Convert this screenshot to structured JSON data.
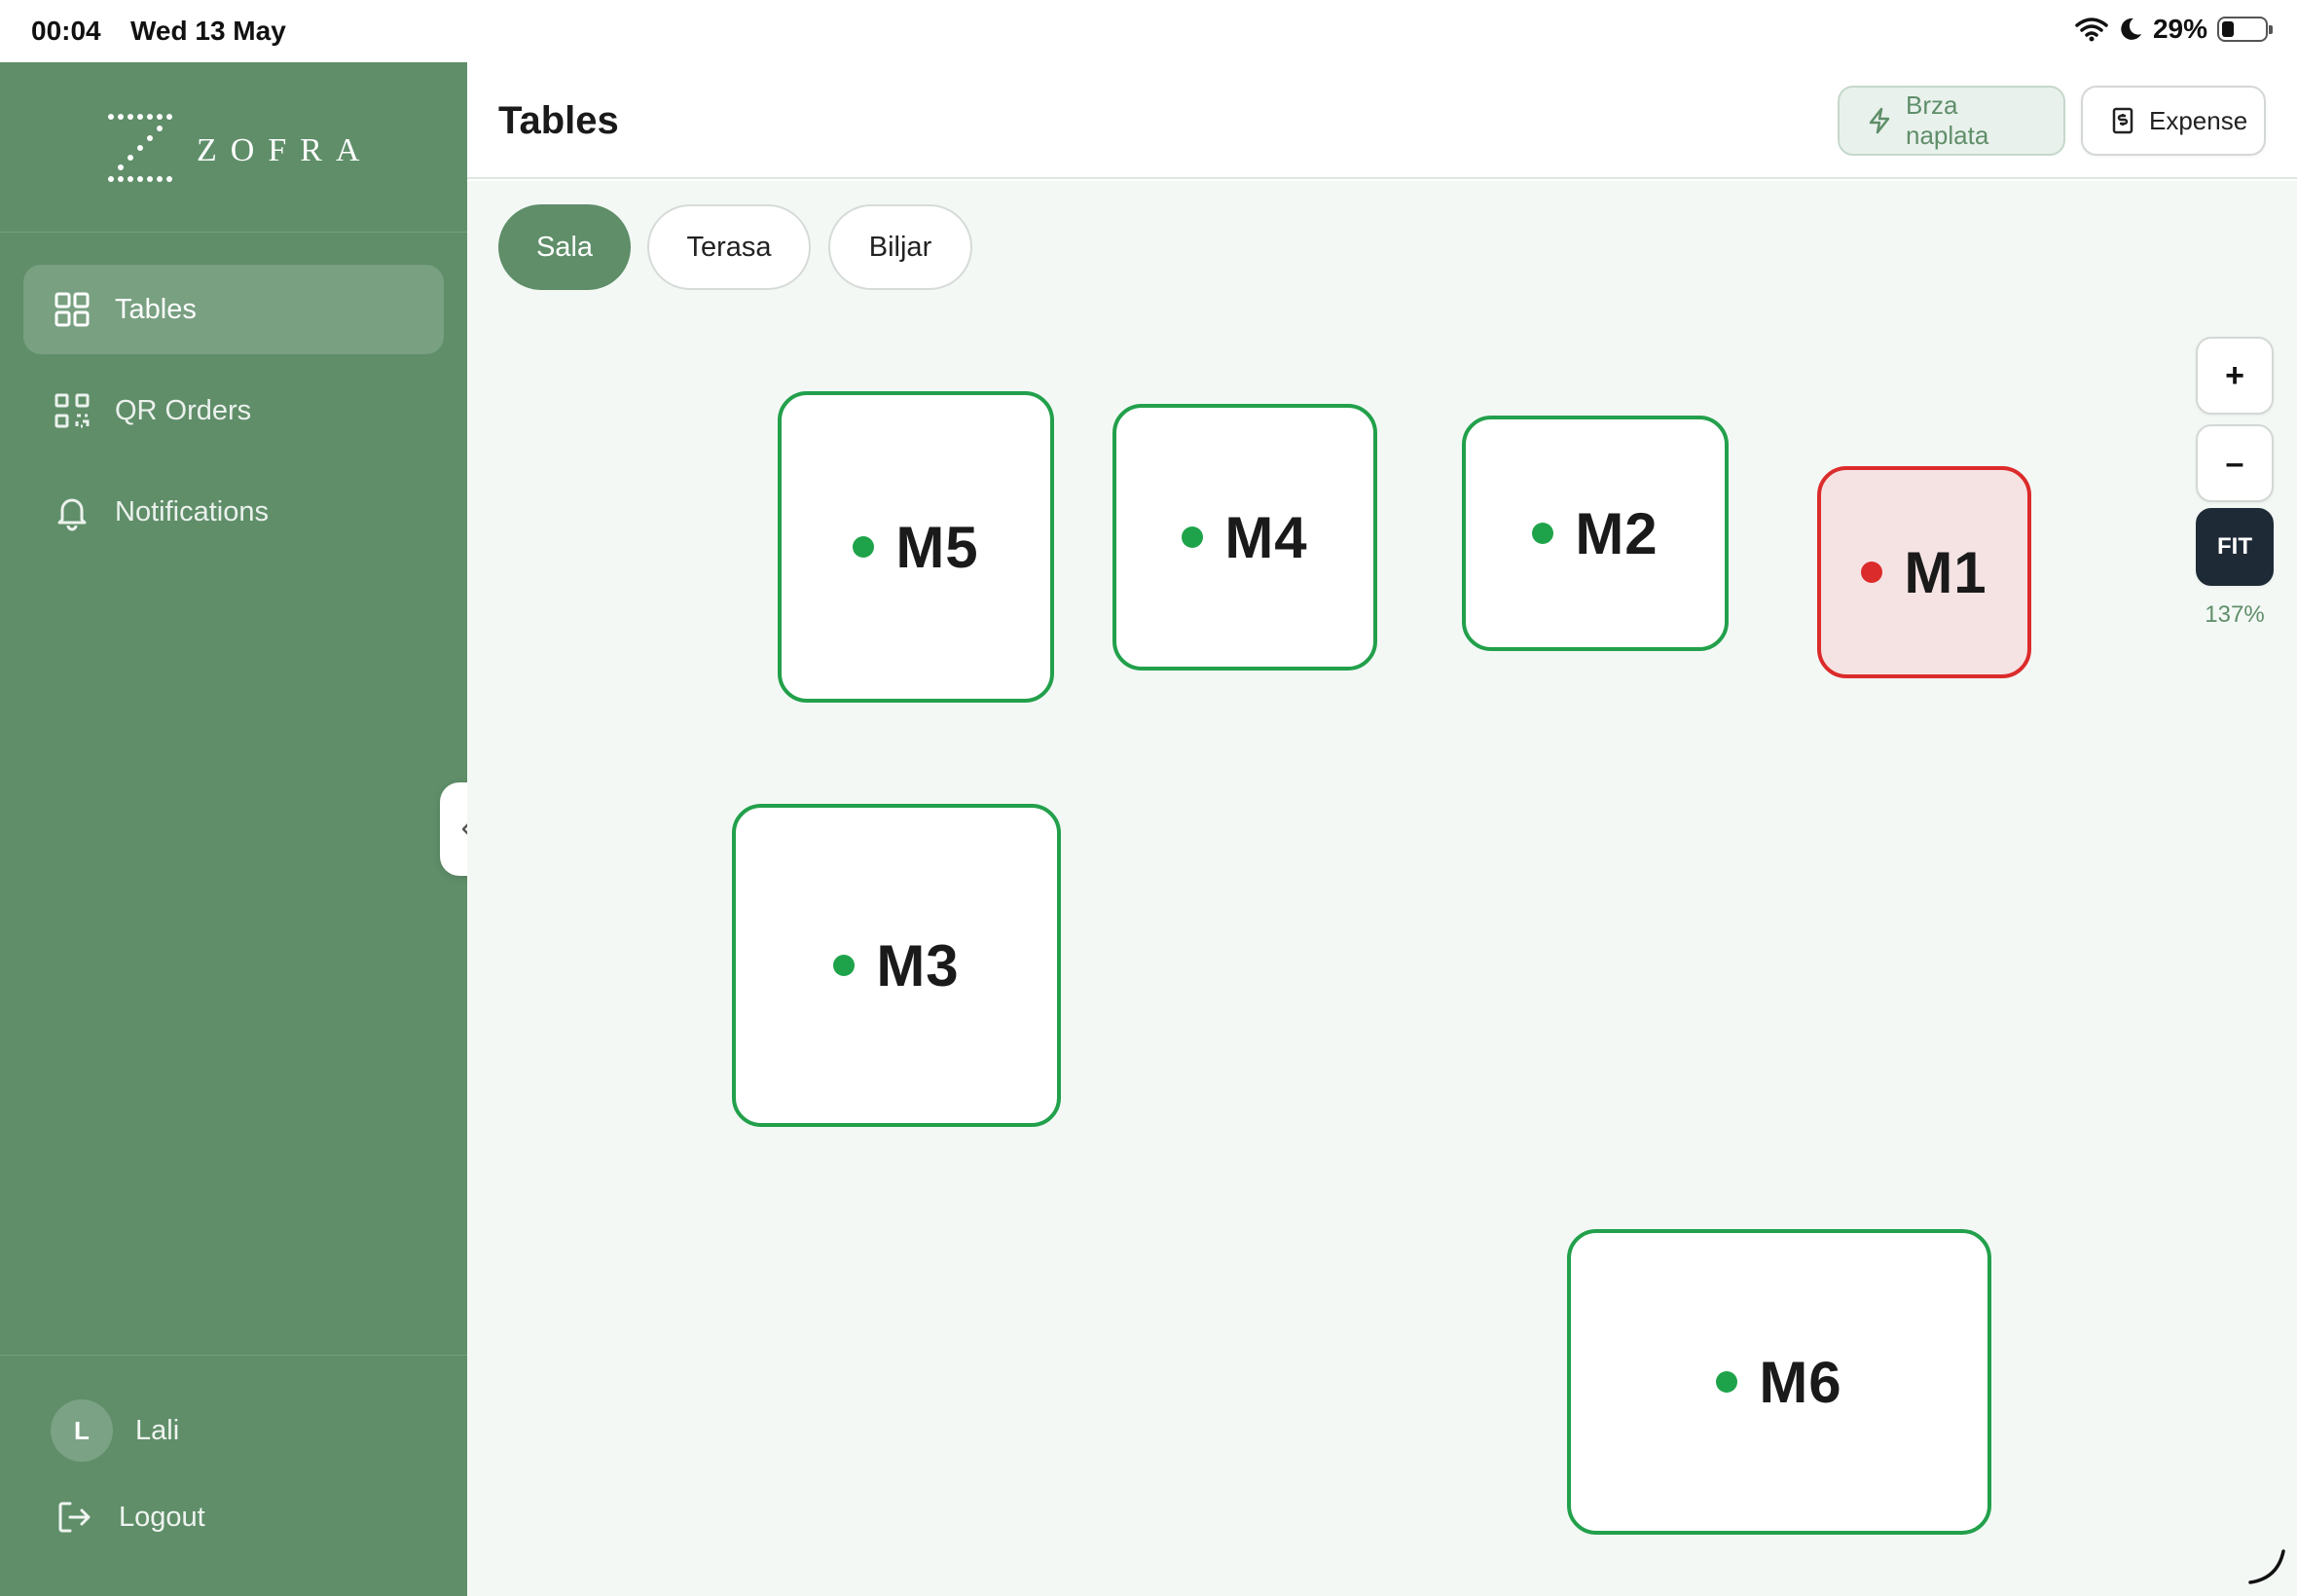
{
  "status_bar": {
    "time": "00:04",
    "date": "Wed 13 May",
    "battery_percent": "29%",
    "battery_level": 0.29
  },
  "sidebar": {
    "brand": "ZOFRA",
    "items": [
      {
        "label": "Tables",
        "icon": "grid-icon",
        "active": true
      },
      {
        "label": "QR Orders",
        "icon": "qr-code-icon",
        "active": false
      },
      {
        "label": "Notifications",
        "icon": "bell-icon",
        "active": false
      }
    ],
    "user": {
      "initial": "L",
      "name": "Lali"
    },
    "logout_label": "Logout"
  },
  "header": {
    "title": "Tables",
    "quick_pay_label": "Brza naplata",
    "expense_label": "Expense"
  },
  "tabs": [
    {
      "label": "Sala",
      "active": true
    },
    {
      "label": "Terasa",
      "active": false
    },
    {
      "label": "Biljar",
      "active": false
    }
  ],
  "tables": [
    {
      "name": "M5",
      "status": "free"
    },
    {
      "name": "M4",
      "status": "free"
    },
    {
      "name": "M2",
      "status": "free"
    },
    {
      "name": "M1",
      "status": "occupied"
    },
    {
      "name": "M3",
      "status": "free"
    },
    {
      "name": "M6",
      "status": "free"
    }
  ],
  "zoom": {
    "plus": "+",
    "minus": "–",
    "fit": "FIT",
    "level": "137%"
  },
  "colors": {
    "sidebar": "#5f8e69",
    "free": "#22a04b",
    "occupied": "#dc2b2b",
    "canvas": "#f3f8f5",
    "fit_button": "#1f2a37"
  }
}
